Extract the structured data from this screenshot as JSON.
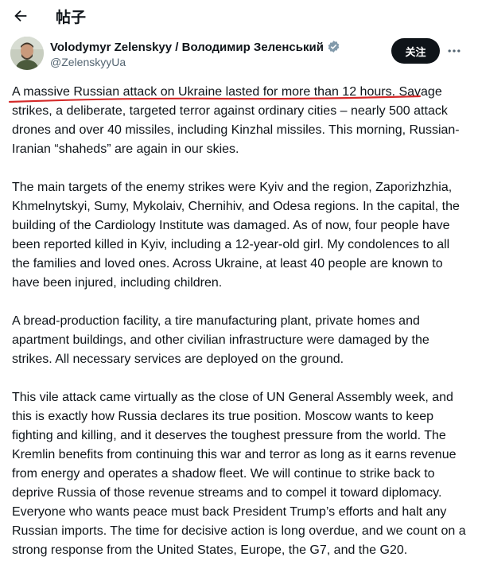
{
  "header": {
    "back_icon": "arrow-left-icon",
    "title": "帖子"
  },
  "author": {
    "name": "Volodymyr Zelenskyy / Володимир Зеленський",
    "handle": "@ZelenskyyUa",
    "verified_icon": "verified-badge-icon",
    "verified_color": "#829aab"
  },
  "actions": {
    "follow_label": "关注",
    "more_icon": "more-horizontal-icon"
  },
  "post": {
    "paragraph1_lead": "A massive Russian attack on Ukraine lasted for more than 12 hours.",
    "paragraph1_rest": " Savage strikes, a deliberate, targeted terror against ordinary cities – nearly 500 attack drones and over 40 missiles, including Kinzhal missiles. This morning, Russian-Iranian “shaheds” are again in our skies.",
    "paragraph2": "The main targets of the enemy strikes were Kyiv and the region, Zaporizhzhia, Khmelnytskyi, Sumy, Mykolaiv, Chernihiv, and Odesa regions. In the capital, the building of the Cardiology Institute was damaged. As of now, four people have been reported killed in Kyiv, including a 12-year-old girl. My condolences to all the families and loved ones. Across Ukraine, at least 40 people are known to have been injured, including children.",
    "paragraph3": "A bread-production facility, a tire manufacturing plant, private homes and apartment buildings, and other civilian infrastructure were damaged by the strikes. All necessary services are deployed on the ground.",
    "paragraph4": "This vile attack came virtually as the close of UN General Assembly week, and this is exactly how Russia declares its true position. Moscow wants to keep fighting and killing, and it deserves the toughest pressure from the world. The Kremlin benefits from continuing this war and terror as long as it earns revenue from energy and operates a shadow fleet. We will continue to strike back to deprive Russia of those revenue streams and to compel it toward diplomacy. Everyone who wants peace must back President Trump’s efforts and halt any Russian imports. The time for decisive action is long overdue, and we count on a strong response from the United States, Europe, the G7, and the G20."
  },
  "annotation": {
    "underline_color": "#d42a2a"
  }
}
